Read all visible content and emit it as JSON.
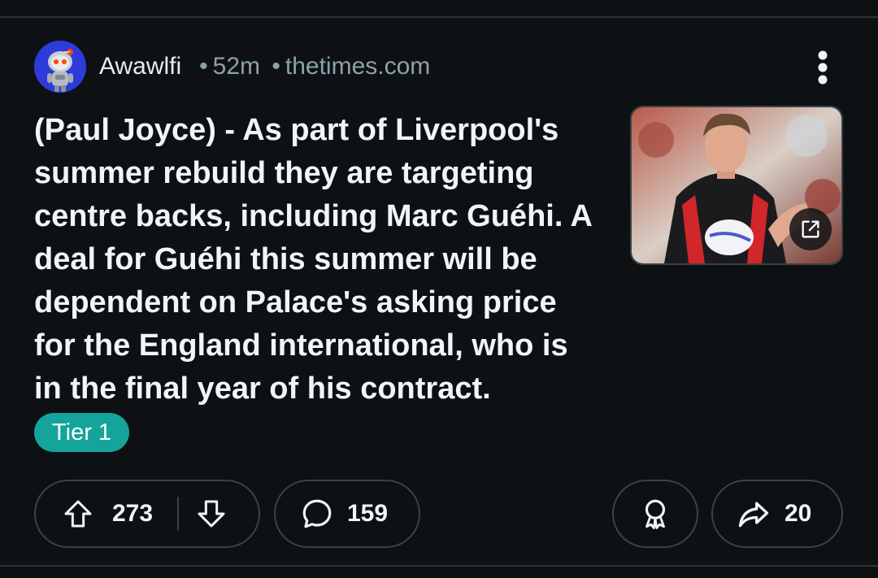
{
  "post": {
    "username": "Awawlfi",
    "age": "52m",
    "domain": "thetimes.com",
    "title": "(Paul Joyce) - As part of Liverpool's summer rebuild they are targeting centre backs, including Marc Guéhi. A deal for Guéhi this summer will be dependent on Palace's asking price for the England international, who is in the final year of his contract.",
    "flair": "Tier 1"
  },
  "actions": {
    "upvotes": "273",
    "comments": "159",
    "shares": "20"
  },
  "icons": {
    "avatar": "snoo-avatar",
    "more": "more-vertical-icon",
    "external": "external-link-icon",
    "upvote": "arrow-up-icon",
    "downvote": "arrow-down-icon",
    "comment": "comment-bubble-icon",
    "award": "award-icon",
    "share": "share-arrow-icon"
  },
  "colors": {
    "background": "#0e1113",
    "flair": "#14a49b",
    "meta": "#8ba2ad",
    "border": "#3a4246"
  }
}
